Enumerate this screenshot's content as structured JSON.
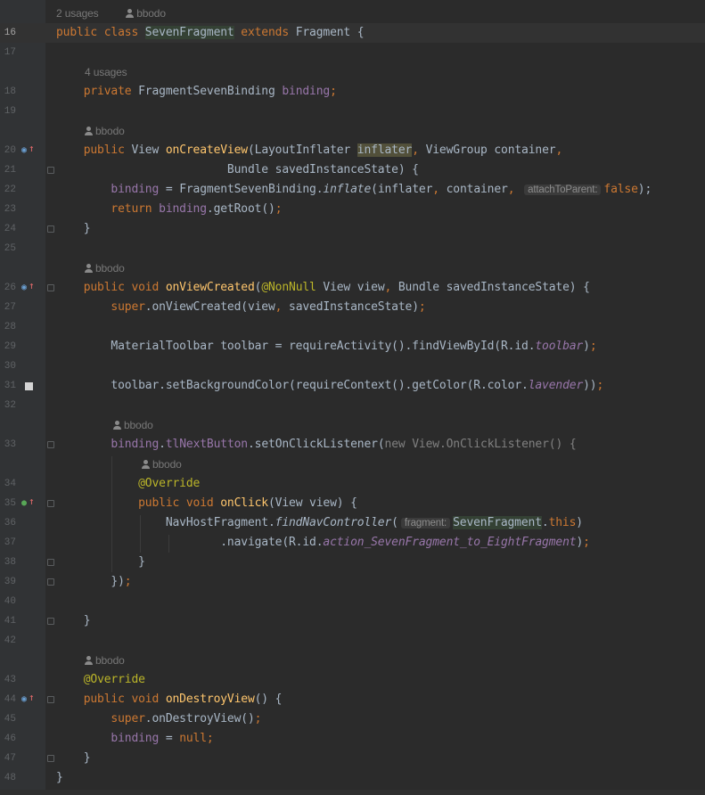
{
  "file": {
    "top_hint": {
      "usages": "2 usages",
      "author": "bbodo"
    },
    "lines": [
      {
        "n": "16",
        "current": true,
        "segments": [
          {
            "t": "public class ",
            "c": "k"
          },
          {
            "t": "SevenFragment",
            "c": "cls-hl"
          },
          {
            "t": " extends ",
            "c": "k"
          },
          {
            "t": "Fragment {",
            "c": ""
          }
        ]
      },
      {
        "n": "17",
        "segments": []
      },
      {
        "hint": "4 usages",
        "indent": 1
      },
      {
        "n": "18",
        "segments": [
          {
            "t": "    private ",
            "c": "k"
          },
          {
            "t": "FragmentSevenBinding ",
            "c": ""
          },
          {
            "t": "binding",
            "c": "fld"
          },
          {
            "t": ";",
            "c": "k"
          }
        ]
      },
      {
        "n": "19",
        "segments": []
      },
      {
        "author": "bbodo",
        "indent": 1
      },
      {
        "n": "20",
        "icon": "override",
        "segments": [
          {
            "t": "    public ",
            "c": "k"
          },
          {
            "t": "View ",
            "c": ""
          },
          {
            "t": "onCreateView",
            "c": "f"
          },
          {
            "t": "(LayoutInflater ",
            "c": ""
          },
          {
            "t": "inflater",
            "c": "par-hl"
          },
          {
            "t": ", ",
            "c": "k"
          },
          {
            "t": "ViewGroup container",
            "c": ""
          },
          {
            "t": ",",
            "c": "k"
          }
        ]
      },
      {
        "n": "21",
        "fold": true,
        "segments": [
          {
            "t": "                         Bundle savedInstanceState) {",
            "c": ""
          }
        ]
      },
      {
        "n": "22",
        "segments": [
          {
            "t": "        ",
            "c": ""
          },
          {
            "t": "binding",
            "c": "fld"
          },
          {
            "t": " = FragmentSevenBinding.",
            "c": ""
          },
          {
            "t": "inflate",
            "c": "it"
          },
          {
            "t": "(inflater",
            "c": ""
          },
          {
            "t": ", ",
            "c": "k"
          },
          {
            "t": "container",
            "c": ""
          },
          {
            "t": ", ",
            "c": "k"
          },
          {
            "hint": "attachToParent:"
          },
          {
            "t": "false",
            "c": "k"
          },
          {
            "t": ");",
            "c": ""
          }
        ]
      },
      {
        "n": "23",
        "segments": [
          {
            "t": "        return ",
            "c": "k"
          },
          {
            "t": "binding",
            "c": "fld"
          },
          {
            "t": ".getRoot()",
            "c": ""
          },
          {
            "t": ";",
            "c": "k"
          }
        ]
      },
      {
        "n": "24",
        "fold": true,
        "segments": [
          {
            "t": "    }",
            "c": ""
          }
        ]
      },
      {
        "n": "25",
        "segments": []
      },
      {
        "author": "bbodo",
        "indent": 1
      },
      {
        "n": "26",
        "icon": "override",
        "fold": true,
        "segments": [
          {
            "t": "    public void ",
            "c": "k"
          },
          {
            "t": "onViewCreated",
            "c": "f"
          },
          {
            "t": "(",
            "c": ""
          },
          {
            "t": "@NonNull ",
            "c": "ann"
          },
          {
            "t": "View view",
            "c": ""
          },
          {
            "t": ", ",
            "c": "k"
          },
          {
            "t": "Bundle savedInstanceState) {",
            "c": ""
          }
        ]
      },
      {
        "n": "27",
        "segments": [
          {
            "t": "        super",
            "c": "k"
          },
          {
            "t": ".onViewCreated(view",
            "c": ""
          },
          {
            "t": ", ",
            "c": "k"
          },
          {
            "t": "savedInstanceState)",
            "c": ""
          },
          {
            "t": ";",
            "c": "k"
          }
        ]
      },
      {
        "n": "28",
        "segments": []
      },
      {
        "n": "29",
        "segments": [
          {
            "t": "        MaterialToolbar toolbar = requireActivity().findViewById(R.id.",
            "c": ""
          },
          {
            "t": "toolbar",
            "c": "ifld"
          },
          {
            "t": ")",
            "c": ""
          },
          {
            "t": ";",
            "c": "k"
          }
        ]
      },
      {
        "n": "30",
        "segments": []
      },
      {
        "n": "31",
        "bookmark": true,
        "segments": [
          {
            "t": "        toolbar.setBackgroundColor(requireContext().getColor(R.color.",
            "c": ""
          },
          {
            "t": "lavender",
            "c": "ifld"
          },
          {
            "t": "))",
            "c": ""
          },
          {
            "t": ";",
            "c": "k"
          }
        ]
      },
      {
        "n": "32",
        "segments": []
      },
      {
        "author": "bbodo",
        "indent": 2
      },
      {
        "n": "33",
        "fold": true,
        "segments": [
          {
            "t": "        ",
            "c": ""
          },
          {
            "t": "binding",
            "c": "fld"
          },
          {
            "t": ".",
            "c": ""
          },
          {
            "t": "tlNextButton",
            "c": "fld"
          },
          {
            "t": ".setOnClickListener(",
            "c": ""
          },
          {
            "t": "new ",
            "c": "gray"
          },
          {
            "t": "View.OnClickListener() {",
            "c": "gray"
          }
        ]
      },
      {
        "author": "bbodo",
        "indent": 3
      },
      {
        "n": "34",
        "segments": [
          {
            "t": "            ",
            "c": ""
          },
          {
            "t": "@Override",
            "c": "ann"
          }
        ]
      },
      {
        "n": "35",
        "icon": "implements",
        "fold": true,
        "segments": [
          {
            "t": "            public void ",
            "c": "k"
          },
          {
            "t": "onClick",
            "c": "f"
          },
          {
            "t": "(View view) {",
            "c": ""
          }
        ]
      },
      {
        "n": "36",
        "segments": [
          {
            "t": "                NavHostFragment.",
            "c": ""
          },
          {
            "t": "findNavController",
            "c": "it"
          },
          {
            "t": "(",
            "c": ""
          },
          {
            "hint": "fragment:"
          },
          {
            "t": "SevenFragment",
            "c": "cls-hl"
          },
          {
            "t": ".",
            "c": ""
          },
          {
            "t": "this",
            "c": "k"
          },
          {
            "t": ")",
            "c": ""
          }
        ]
      },
      {
        "n": "37",
        "segments": [
          {
            "t": "                        .navigate(R.id.",
            "c": ""
          },
          {
            "t": "action_SevenFragment_to_EightFragment",
            "c": "ifld"
          },
          {
            "t": ")",
            "c": ""
          },
          {
            "t": ";",
            "c": "k"
          }
        ]
      },
      {
        "n": "38",
        "fold": true,
        "segments": [
          {
            "t": "            }",
            "c": ""
          }
        ]
      },
      {
        "n": "39",
        "fold": true,
        "segments": [
          {
            "t": "        })",
            "c": ""
          },
          {
            "t": ";",
            "c": "k"
          }
        ]
      },
      {
        "n": "40",
        "segments": []
      },
      {
        "n": "41",
        "fold": true,
        "segments": [
          {
            "t": "    }",
            "c": ""
          }
        ]
      },
      {
        "n": "42",
        "segments": []
      },
      {
        "author": "bbodo",
        "indent": 1
      },
      {
        "n": "43",
        "segments": [
          {
            "t": "    ",
            "c": ""
          },
          {
            "t": "@Override",
            "c": "ann"
          }
        ]
      },
      {
        "n": "44",
        "icon": "override",
        "fold": true,
        "segments": [
          {
            "t": "    public void ",
            "c": "k"
          },
          {
            "t": "onDestroyView",
            "c": "f"
          },
          {
            "t": "() {",
            "c": ""
          }
        ]
      },
      {
        "n": "45",
        "segments": [
          {
            "t": "        super",
            "c": "k"
          },
          {
            "t": ".onDestroyView()",
            "c": ""
          },
          {
            "t": ";",
            "c": "k"
          }
        ]
      },
      {
        "n": "46",
        "segments": [
          {
            "t": "        ",
            "c": ""
          },
          {
            "t": "binding",
            "c": "fld"
          },
          {
            "t": " = ",
            "c": ""
          },
          {
            "t": "null",
            "c": "k"
          },
          {
            "t": ";",
            "c": "k"
          }
        ]
      },
      {
        "n": "47",
        "fold": true,
        "segments": [
          {
            "t": "    }",
            "c": ""
          }
        ]
      },
      {
        "n": "48",
        "segments": [
          {
            "t": "}",
            "c": ""
          }
        ]
      }
    ]
  },
  "icons": {
    "override": "override-gutter-icon",
    "implements": "implements-gutter-icon",
    "bookmark": "bookmark-icon",
    "fold": "fold-marker-icon",
    "author": "person-icon"
  },
  "colors": {
    "background": "#2b2b2b",
    "gutter": "#313335",
    "keyword": "#cc7832",
    "method": "#ffc66d",
    "field": "#9876aa",
    "annotation": "#bbb529",
    "text": "#a9b7c6"
  }
}
